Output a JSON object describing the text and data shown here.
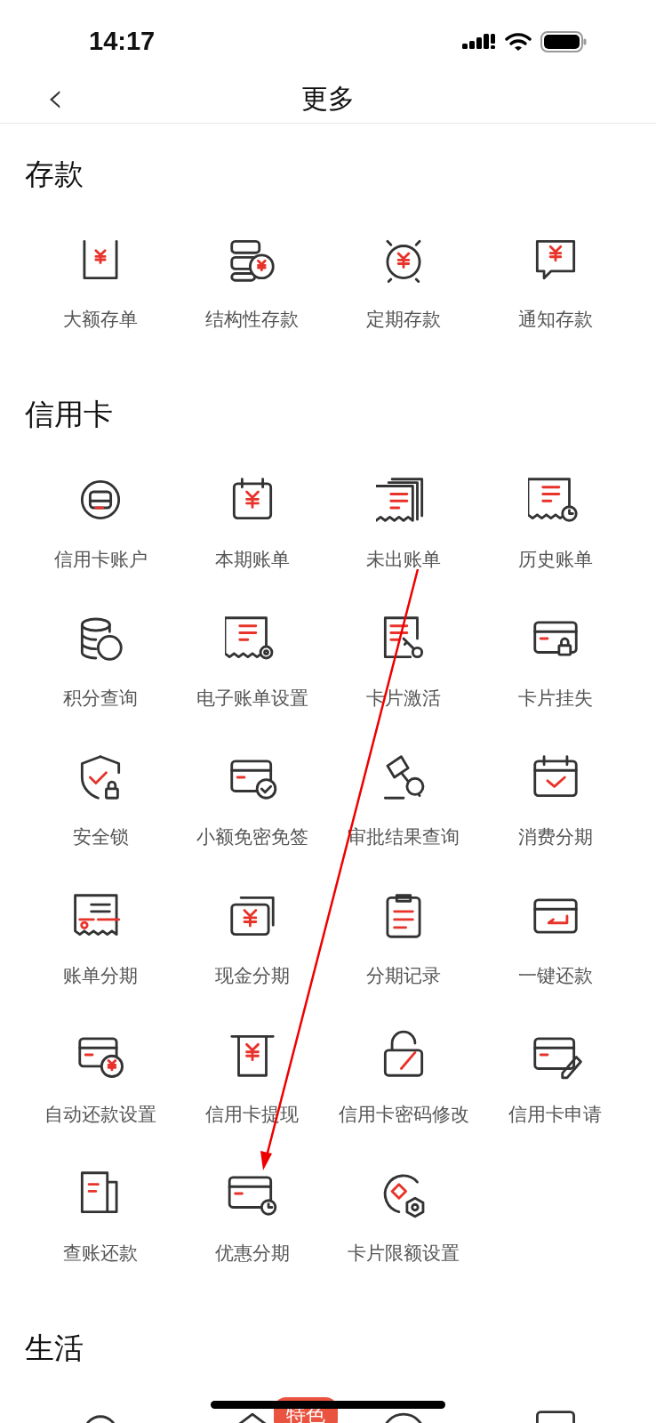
{
  "status_bar": {
    "time": "14:17"
  },
  "nav": {
    "back": "‹",
    "title": "更多"
  },
  "sections": [
    {
      "title": "存款",
      "items": [
        {
          "label": "大额存单"
        },
        {
          "label": "结构性存款"
        },
        {
          "label": "定期存款"
        },
        {
          "label": "通知存款"
        }
      ]
    },
    {
      "title": "信用卡",
      "items": [
        {
          "label": "信用卡账户"
        },
        {
          "label": "本期账单"
        },
        {
          "label": "未出账单"
        },
        {
          "label": "历史账单"
        },
        {
          "label": "积分查询"
        },
        {
          "label": "电子账单设置"
        },
        {
          "label": "卡片激活"
        },
        {
          "label": "卡片挂失"
        },
        {
          "label": "安全锁"
        },
        {
          "label": "小额免密免签"
        },
        {
          "label": "审批结果查询"
        },
        {
          "label": "消费分期"
        },
        {
          "label": "账单分期"
        },
        {
          "label": "现金分期"
        },
        {
          "label": "分期记录"
        },
        {
          "label": "一键还款"
        },
        {
          "label": "自动还款设置"
        },
        {
          "label": "信用卡提现"
        },
        {
          "label": "信用卡密码修改"
        },
        {
          "label": "信用卡申请"
        },
        {
          "label": "查账还款"
        },
        {
          "label": "优惠分期"
        },
        {
          "label": "卡片限额设置"
        }
      ]
    },
    {
      "title": "生活",
      "badge": "特色"
    }
  ]
}
